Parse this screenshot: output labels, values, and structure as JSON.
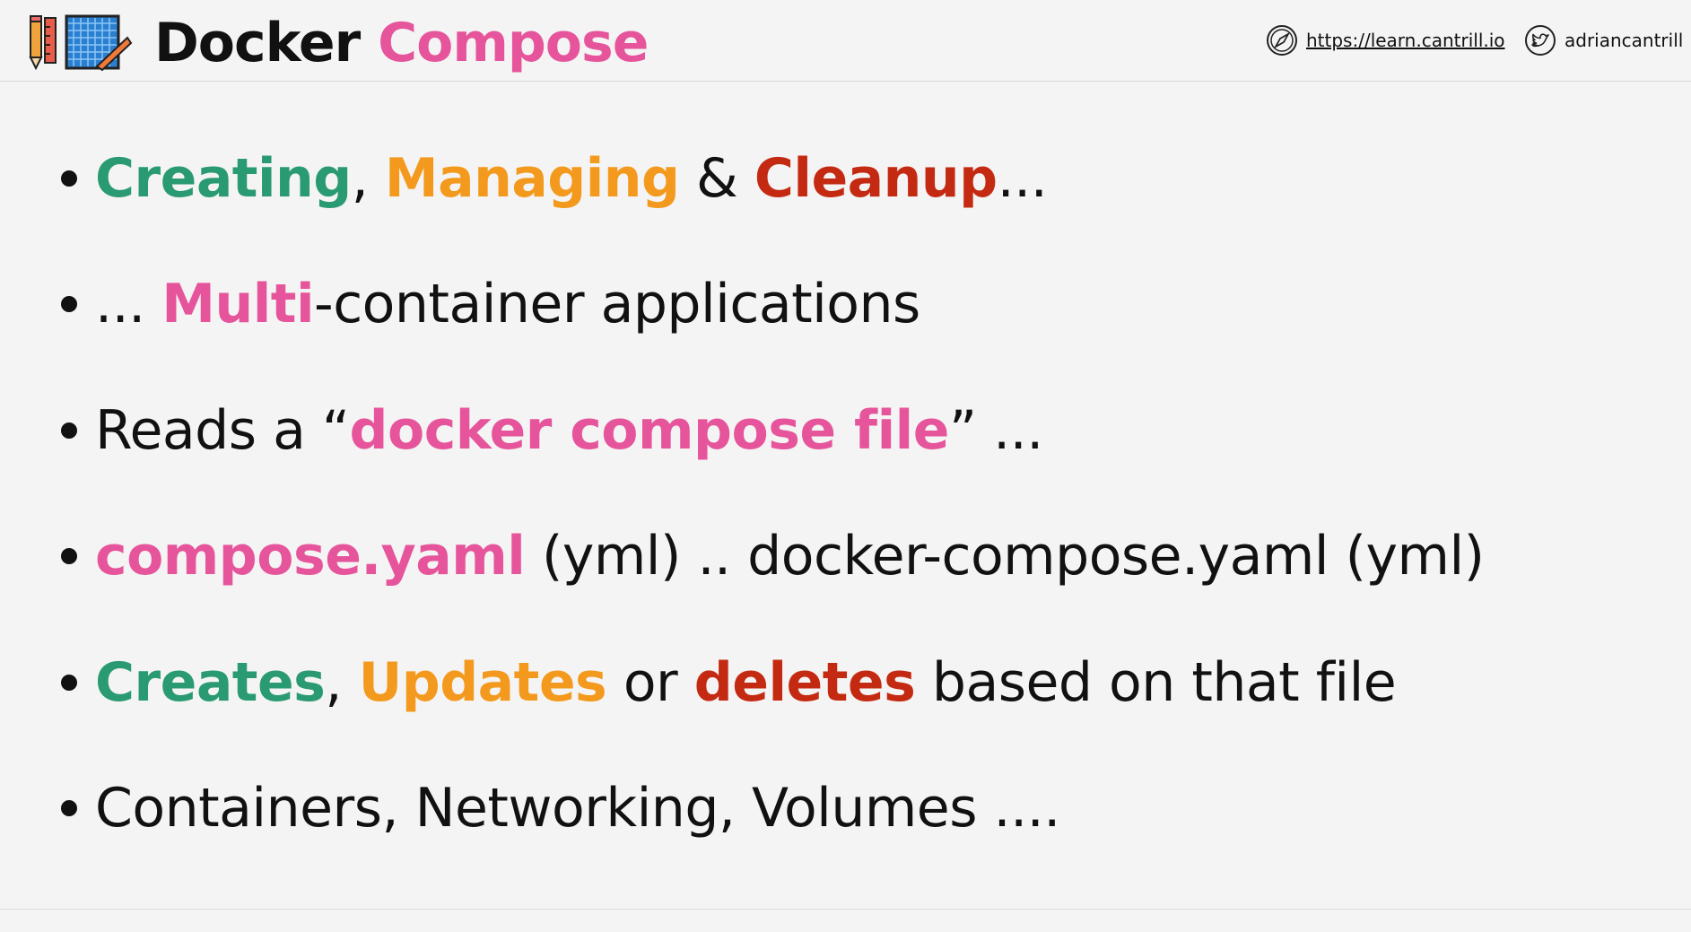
{
  "header": {
    "title_part1": "Docker",
    "title_part2": "Compose",
    "website": "https://learn.cantrill.io",
    "handle": "adriancantrill"
  },
  "icons": {
    "logo": "pencil-ruler-blueprint-icon",
    "website": "compass-icon",
    "handle": "twitter-icon"
  },
  "colors": {
    "accent_pink": "#e6559b",
    "green": "#2a9a72",
    "orange": "#f39a1e",
    "red": "#c42a12",
    "background": "#f4f4f4"
  },
  "bullets": [
    {
      "segments": [
        {
          "text": "Creating",
          "style": "green bold"
        },
        {
          "text": ", ",
          "style": ""
        },
        {
          "text": "Managing",
          "style": "orange bold"
        },
        {
          "text": " & ",
          "style": ""
        },
        {
          "text": "Cleanup",
          "style": "red bold"
        },
        {
          "text": "...",
          "style": ""
        }
      ]
    },
    {
      "segments": [
        {
          "text": "... ",
          "style": ""
        },
        {
          "text": "Multi",
          "style": "pink bold"
        },
        {
          "text": "-container applications",
          "style": ""
        }
      ]
    },
    {
      "segments": [
        {
          "text": "Reads a “",
          "style": ""
        },
        {
          "text": "docker compose file",
          "style": "pink bold"
        },
        {
          "text": "” ...",
          "style": ""
        }
      ]
    },
    {
      "segments": [
        {
          "text": "compose.yaml",
          "style": "pink bold"
        },
        {
          "text": " (yml) .. docker-compose.yaml (yml)",
          "style": ""
        }
      ]
    },
    {
      "segments": [
        {
          "text": "Creates",
          "style": "green bold"
        },
        {
          "text": ", ",
          "style": ""
        },
        {
          "text": "Updates",
          "style": "orange bold"
        },
        {
          "text": " or ",
          "style": ""
        },
        {
          "text": "deletes",
          "style": "red bold"
        },
        {
          "text": " based on that file",
          "style": ""
        }
      ]
    },
    {
      "segments": [
        {
          "text": "Containers, Networking, Volumes ....",
          "style": ""
        }
      ]
    }
  ]
}
